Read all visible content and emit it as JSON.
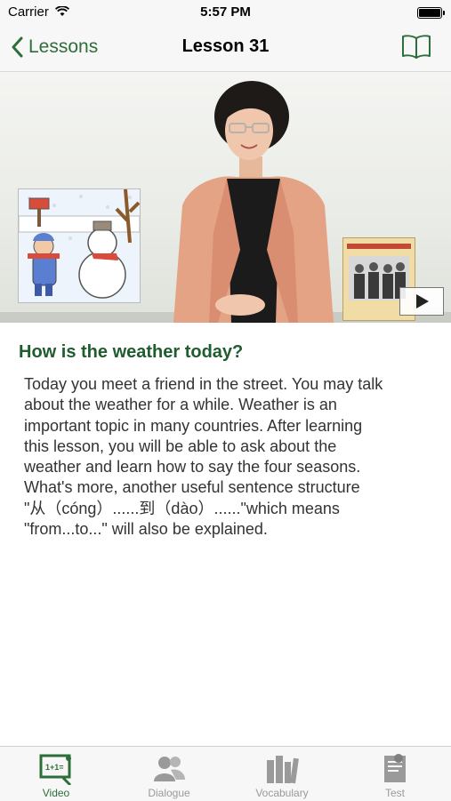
{
  "status_bar": {
    "carrier": "Carrier",
    "time": "5:57 PM"
  },
  "nav": {
    "back_label": "Lessons",
    "title": "Lesson 31",
    "book_icon": "book-icon"
  },
  "video": {
    "play_icon": "play-icon"
  },
  "lesson": {
    "heading": "How is the weather today?",
    "lines": [
      "Today you meet a friend in the street. You may talk",
      "about the weather for a while. Weather is an",
      "important topic in many countries. After learning",
      "this lesson, you will be able to ask about the",
      "weather and learn how to say the four seasons.",
      "What's more, another useful sentence structure",
      "\"从（cóng）......到（dào）......\"which means",
      "\"from...to...\" will also be explained."
    ]
  },
  "tabs": [
    {
      "label": "Video",
      "icon": "video-board-icon",
      "active": true
    },
    {
      "label": "Dialogue",
      "icon": "people-icon",
      "active": false
    },
    {
      "label": "Vocabulary",
      "icon": "books-icon",
      "active": false
    },
    {
      "label": "Test",
      "icon": "test-paper-icon",
      "active": false
    }
  ],
  "colors": {
    "accent": "#2e6e3a",
    "heading": "#1f5c2e",
    "inactive": "#9a9a9a"
  }
}
